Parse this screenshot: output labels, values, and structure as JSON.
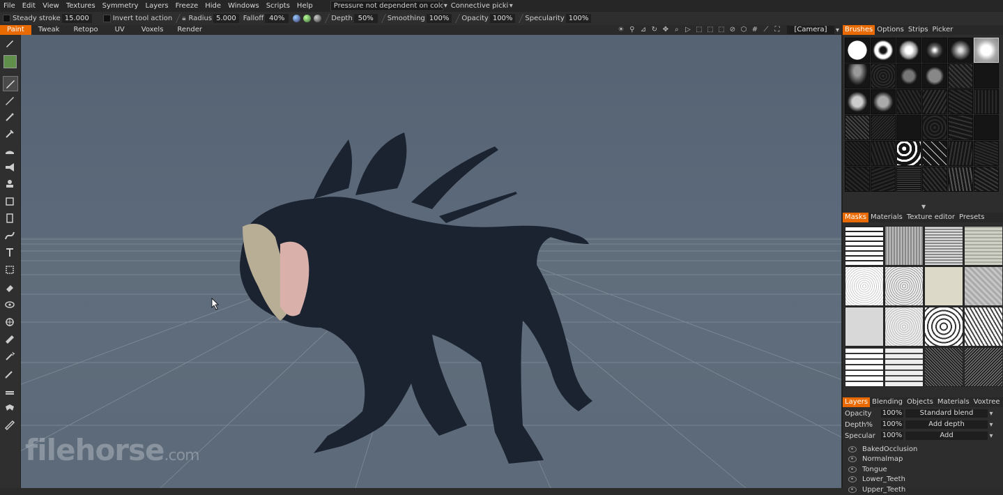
{
  "menu": [
    "File",
    "Edit",
    "View",
    "Textures",
    "Symmetry",
    "Layers",
    "Freeze",
    "Hide",
    "Windows",
    "Scripts",
    "Help"
  ],
  "menu_drop_pressure": "Pressure not dependent on colo",
  "menu_drop_connective": "Connective picki",
  "toolbar": {
    "steady_label": "Steady stroke",
    "steady_value": "15.000",
    "invert_label": "Invert tool action",
    "radius_label": "Radius",
    "radius_value": "5.000",
    "falloff_label": "Falloff",
    "falloff_value": "40%",
    "depth_label": "Depth",
    "depth_value": "50%",
    "smoothing_label": "Smoothing",
    "smoothing_value": "100%",
    "opacity_label": "Opacity",
    "opacity_value": "100%",
    "specularity_label": "Specularity",
    "specularity_value": "100%"
  },
  "rooms": [
    "Paint",
    "Tweak",
    "Retopo",
    "UV",
    "Voxels",
    "Render"
  ],
  "camera": "[Camera]",
  "brush_panel": {
    "tabs": [
      "Brushes",
      "Options",
      "Strips",
      "Picker"
    ]
  },
  "mask_panel": {
    "tabs": [
      "Masks",
      "Materials",
      "Texture editor",
      "Presets"
    ]
  },
  "layers_panel": {
    "tabs": [
      "Layers",
      "Blending",
      "Objects",
      "Materials",
      "Voxtree"
    ],
    "opacity_label": "Opacity",
    "opacity_value": "100%",
    "opacity_mode": "Standard blend",
    "depth_label": "Depth%",
    "depth_value": "100%",
    "depth_mode": "Add depth",
    "specular_label": "Specular",
    "specular_value": "100%",
    "specular_mode": "Add",
    "layers": [
      "BakedOcclusion",
      "Normalmap",
      "Tongue",
      "Lower_Teeth",
      "Upper_Teeth"
    ]
  },
  "watermark": {
    "brand": "filehorse",
    "tld": ".com"
  },
  "colors": {
    "accent": "#e86a00",
    "viewport": "#5b697a",
    "panel": "#2d2d2d"
  }
}
